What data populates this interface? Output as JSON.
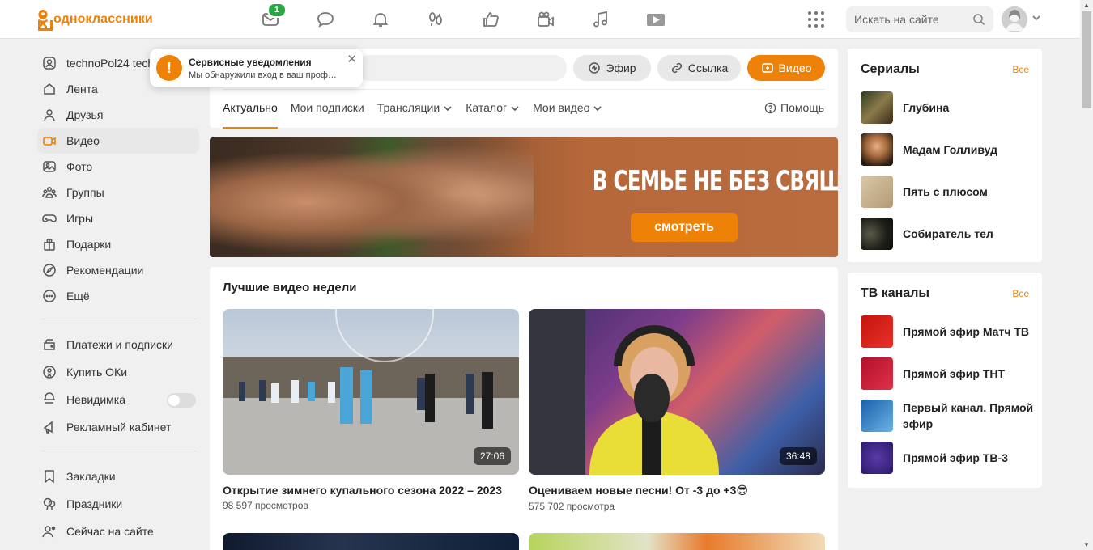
{
  "header": {
    "logo_text": "одноклассники",
    "messages_badge": "1",
    "search_placeholder": "Искать на сайте",
    "brand_color": "#ee8208"
  },
  "nav_icons": [
    "messages-icon",
    "discussions-icon",
    "notifications-icon",
    "guests-icon",
    "marks-icon",
    "video-icon",
    "music-icon",
    "games-icon"
  ],
  "sidebar": {
    "items": [
      {
        "label": "technoPol24 tech",
        "icon": "profile-icon"
      },
      {
        "label": "Лента",
        "icon": "home-icon"
      },
      {
        "label": "Друзья",
        "icon": "friends-icon"
      },
      {
        "label": "Видео",
        "icon": "video-icon"
      },
      {
        "label": "Фото",
        "icon": "photo-icon"
      },
      {
        "label": "Группы",
        "icon": "groups-icon"
      },
      {
        "label": "Игры",
        "icon": "gamepad-icon"
      },
      {
        "label": "Подарки",
        "icon": "gift-icon"
      },
      {
        "label": "Рекомендации",
        "icon": "compass-icon"
      },
      {
        "label": "Ещё",
        "icon": "more-icon"
      }
    ],
    "items2": [
      {
        "label": "Платежи и подписки",
        "icon": "payments-icon"
      },
      {
        "label": "Купить ОКи",
        "icon": "coin-icon"
      },
      {
        "label": "Невидимка",
        "icon": "incognito-icon"
      },
      {
        "label": "Рекламный кабинет",
        "icon": "megaphone-icon"
      }
    ],
    "items3": [
      {
        "label": "Закладки",
        "icon": "bookmark-icon"
      },
      {
        "label": "Праздники",
        "icon": "balloon-icon"
      },
      {
        "label": "Сейчас на сайте",
        "icon": "online-users-icon"
      }
    ]
  },
  "popup": {
    "title": "Сервисные уведомления",
    "text": "Мы обнаружили вход в ваш проф…"
  },
  "video_toolbar": {
    "live_label": "Эфир",
    "link_label": "Ссылка",
    "video_label": "Видео"
  },
  "tabs": [
    {
      "label": "Актуально",
      "dropdown": false
    },
    {
      "label": "Мои подписки",
      "dropdown": false
    },
    {
      "label": "Трансляции",
      "dropdown": true
    },
    {
      "label": "Каталог",
      "dropdown": true
    },
    {
      "label": "Мои видео",
      "dropdown": true
    }
  ],
  "help_label": "Помощь",
  "banner": {
    "title": "В СЕМЬЕ НЕ БЕЗ СВЯЩЕННИКА",
    "button": "смотреть"
  },
  "best": {
    "title": "Лучшие видео недели",
    "videos": [
      {
        "title": "Открытие зимнего купального сезона 2022 – 2023",
        "views": "98 597 просмотров",
        "duration": "27:06"
      },
      {
        "title": "Оцениваем новые песни! От -3 до +3😎",
        "views": "575 702 просмотра",
        "duration": "36:48"
      }
    ]
  },
  "series": {
    "title": "Сериалы",
    "all": "Все",
    "items": [
      "Глубина",
      "Мадам Голливуд",
      "Пять с плюсом",
      "Собиратель тел"
    ]
  },
  "tv": {
    "title": "ТВ каналы",
    "all": "Все",
    "items": [
      "Прямой эфир Матч ТВ",
      "Прямой эфир ТНТ",
      "Первый канал. Прямой эфир",
      "Прямой эфир ТВ-3"
    ]
  }
}
